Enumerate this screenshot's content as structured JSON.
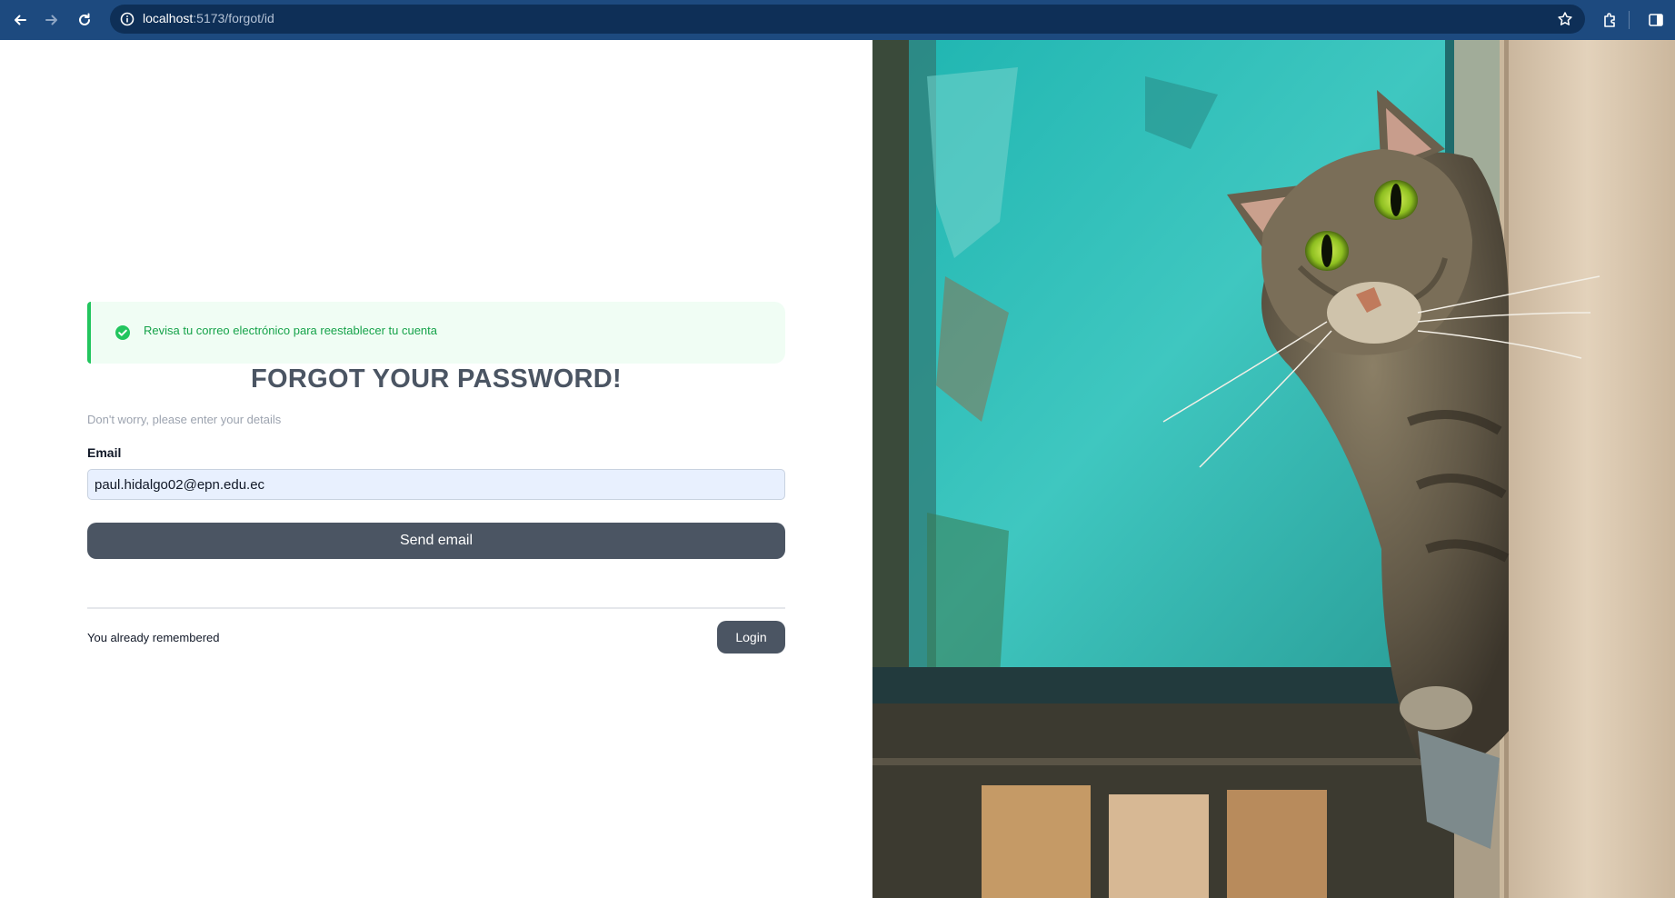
{
  "browser": {
    "url_host": "localhost",
    "url_path": ":5173/forgot/id",
    "icons": [
      "back-arrow-icon",
      "forward-arrow-icon",
      "reload-icon",
      "site-info-icon",
      "star-icon",
      "extensions-icon",
      "side-panel-icon"
    ]
  },
  "alert": {
    "message": "Revisa tu correo electrónico para reestablecer tu cuenta",
    "icon": "check-circle-icon",
    "color": "#16a34a",
    "background": "#f0fdf4",
    "border_color": "#22c55e"
  },
  "form": {
    "title": "FORGOT YOUR PASSWORD!",
    "subtitle": "Don't worry, please enter your details",
    "email_label": "Email",
    "email_value": "paul.hidalgo02@epn.edu.ec",
    "send_button": "Send email",
    "remember_text": "You already remembered",
    "login_button": "Login"
  },
  "theme": {
    "chrome_bg": "#1d4a7f",
    "button_bg": "#4b5563",
    "input_bg": "#e8f0fe"
  },
  "image": {
    "icon": "cat-photo"
  }
}
